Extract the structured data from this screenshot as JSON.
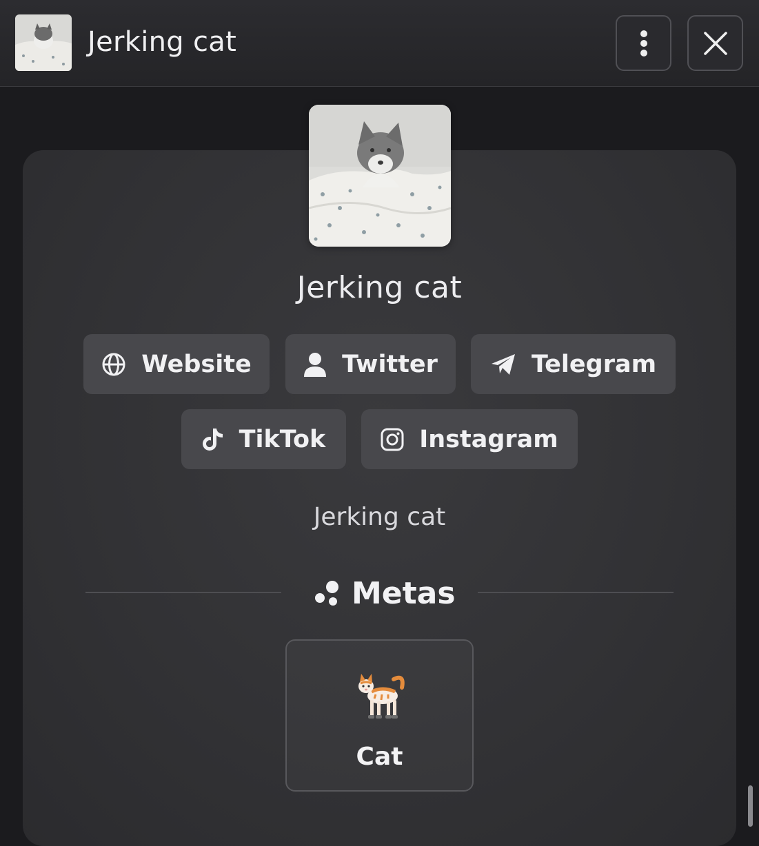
{
  "header": {
    "title": "Jerking cat",
    "more_icon": "more-vertical-icon",
    "close_icon": "close-icon"
  },
  "token": {
    "name": "Jerking cat",
    "description": "Jerking cat"
  },
  "links": [
    {
      "label": "Website",
      "icon": "globe-icon"
    },
    {
      "label": "Twitter",
      "icon": "user-icon"
    },
    {
      "label": "Telegram",
      "icon": "telegram-icon"
    },
    {
      "label": "TikTok",
      "icon": "tiktok-icon"
    },
    {
      "label": "Instagram",
      "icon": "instagram-icon"
    }
  ],
  "metas": {
    "title": "Metas",
    "items": [
      {
        "label": "Cat",
        "icon": "cat-emoji-icon"
      }
    ]
  },
  "colors": {
    "background": "#1b1b1e",
    "card": "#323235",
    "button": "#48484c",
    "text": "#f1f1f3"
  }
}
